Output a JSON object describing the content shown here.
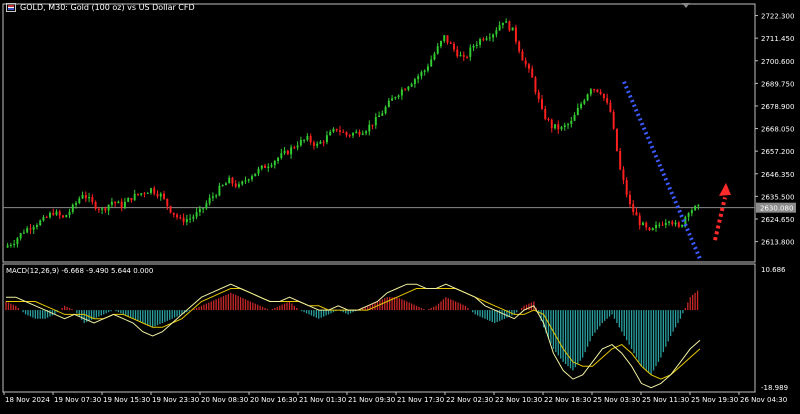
{
  "header": {
    "title": "GOLD, M30:  Gold (100 oz) vs US Dollar CFD",
    "flag_icon": "us-flag-icon"
  },
  "macd_header": {
    "label": "MACD(12,26,9) -6.668 -9.490 5.644 0.000"
  },
  "colors": {
    "background": "#000000",
    "bull_candle": "#32cd32",
    "bear_candle": "#ff2020",
    "price_line": "#8c8c8c",
    "trend_line": "#3c5aff",
    "arrow": "#ff2a2a",
    "hist_pos": "#c82828",
    "hist_neg": "#2aa0a0",
    "macd_line": "#f0f0a0",
    "signal_line": "#e6c800"
  },
  "chart_data": [
    {
      "type": "candlestick",
      "title": "GOLD, M30:  Gold (100 oz) vs US Dollar CFD",
      "ylim": [
        2604.0,
        2724.0
      ],
      "y_ticks": [
        "2722.300",
        "2711.450",
        "2700.600",
        "2689.750",
        "2678.900",
        "2668.050",
        "2657.200",
        "2646.350",
        "2635.500",
        "2624.650",
        "2613.800"
      ],
      "current_price": "2630.080",
      "x_ticks": [
        "18 Nov 2024",
        "19 Nov 07:30",
        "19 Nov 15:30",
        "19 Nov 23:30",
        "20 Nov 08:30",
        "20 Nov 16:30",
        "21 Nov 01:30",
        "21 Nov 09:30",
        "21 Nov 17:30",
        "22 Nov 02:30",
        "22 Nov 10:30",
        "22 Nov 18:30",
        "25 Nov 03:30",
        "25 Nov 11:30",
        "25 Nov 19:30",
        "26 Nov 04:30"
      ],
      "close_path": [
        2611,
        2614,
        2619,
        2622,
        2624,
        2628,
        2625,
        2630,
        2637,
        2632,
        2629,
        2633,
        2631,
        2635,
        2637,
        2639,
        2636,
        2629,
        2624,
        2625,
        2628,
        2634,
        2639,
        2643,
        2640,
        2645,
        2648,
        2651,
        2654,
        2657,
        2661,
        2663,
        2660,
        2664,
        2668,
        2665,
        2666,
        2668,
        2672,
        2678,
        2684,
        2688,
        2692,
        2696,
        2704,
        2712,
        2706,
        2701,
        2708,
        2712,
        2714,
        2720,
        2715,
        2702,
        2692,
        2676,
        2669,
        2668,
        2671,
        2680,
        2688,
        2686,
        2676,
        2648,
        2631,
        2623,
        2618,
        2622,
        2625,
        2620,
        2629,
        2630
      ]
    },
    {
      "type": "bar+line",
      "title": "MACD(12,26,9) -6.668 -9.490 5.644 0.000",
      "ylim": [
        -18.989,
        10.686
      ],
      "y_ticks": [
        "10.686",
        "-18.989"
      ],
      "histogram": [
        2,
        1,
        -1,
        -2,
        -2,
        -1,
        1,
        0,
        -3,
        -2,
        -1,
        0,
        -1,
        -2,
        -3,
        -4,
        -3,
        -2,
        -1,
        0,
        1,
        2,
        3,
        4,
        3,
        2,
        1,
        0,
        1,
        2,
        0,
        -1,
        -2,
        -1,
        0,
        -1,
        0,
        1,
        2,
        3,
        3,
        2,
        1,
        0,
        1,
        3,
        2,
        1,
        -1,
        -2,
        -3,
        -2,
        -1,
        1,
        2,
        -4,
        -9,
        -12,
        -14,
        -11,
        -6,
        -3,
        -1,
        -5,
        -9,
        -13,
        -15,
        -11,
        -6,
        -2,
        3,
        5
      ],
      "macd_line": [
        3,
        3,
        2,
        1,
        0,
        -1,
        -2,
        -1,
        -2,
        -3,
        -2,
        -1,
        -2,
        -3,
        -5,
        -6,
        -5,
        -3,
        -1,
        1,
        3,
        4,
        5,
        6,
        5,
        4,
        3,
        2,
        2,
        3,
        2,
        1,
        0,
        0,
        1,
        0,
        0,
        1,
        2,
        4,
        5,
        6,
        6,
        5,
        5,
        6,
        5,
        4,
        3,
        1,
        0,
        -1,
        -2,
        0,
        1,
        -3,
        -10,
        -14,
        -16,
        -15,
        -12,
        -9,
        -8,
        -10,
        -13,
        -17,
        -18,
        -17,
        -15,
        -12,
        -9,
        -7
      ],
      "signal_line": [
        2,
        2,
        2,
        2,
        1,
        0,
        -1,
        -1,
        -1,
        -2,
        -2,
        -1,
        -1,
        -2,
        -3,
        -4,
        -4,
        -3,
        -2,
        0,
        2,
        3,
        4,
        5,
        5,
        4,
        3,
        2,
        2,
        2,
        2,
        1,
        1,
        0,
        0,
        0,
        0,
        0,
        1,
        2,
        3,
        4,
        5,
        5,
        5,
        5,
        5,
        4,
        3,
        2,
        1,
        0,
        -1,
        -1,
        0,
        -1,
        -5,
        -9,
        -12,
        -13,
        -13,
        -11,
        -9,
        -8,
        -10,
        -13,
        -15,
        -16,
        -15,
        -13,
        -11,
        -9
      ]
    }
  ]
}
